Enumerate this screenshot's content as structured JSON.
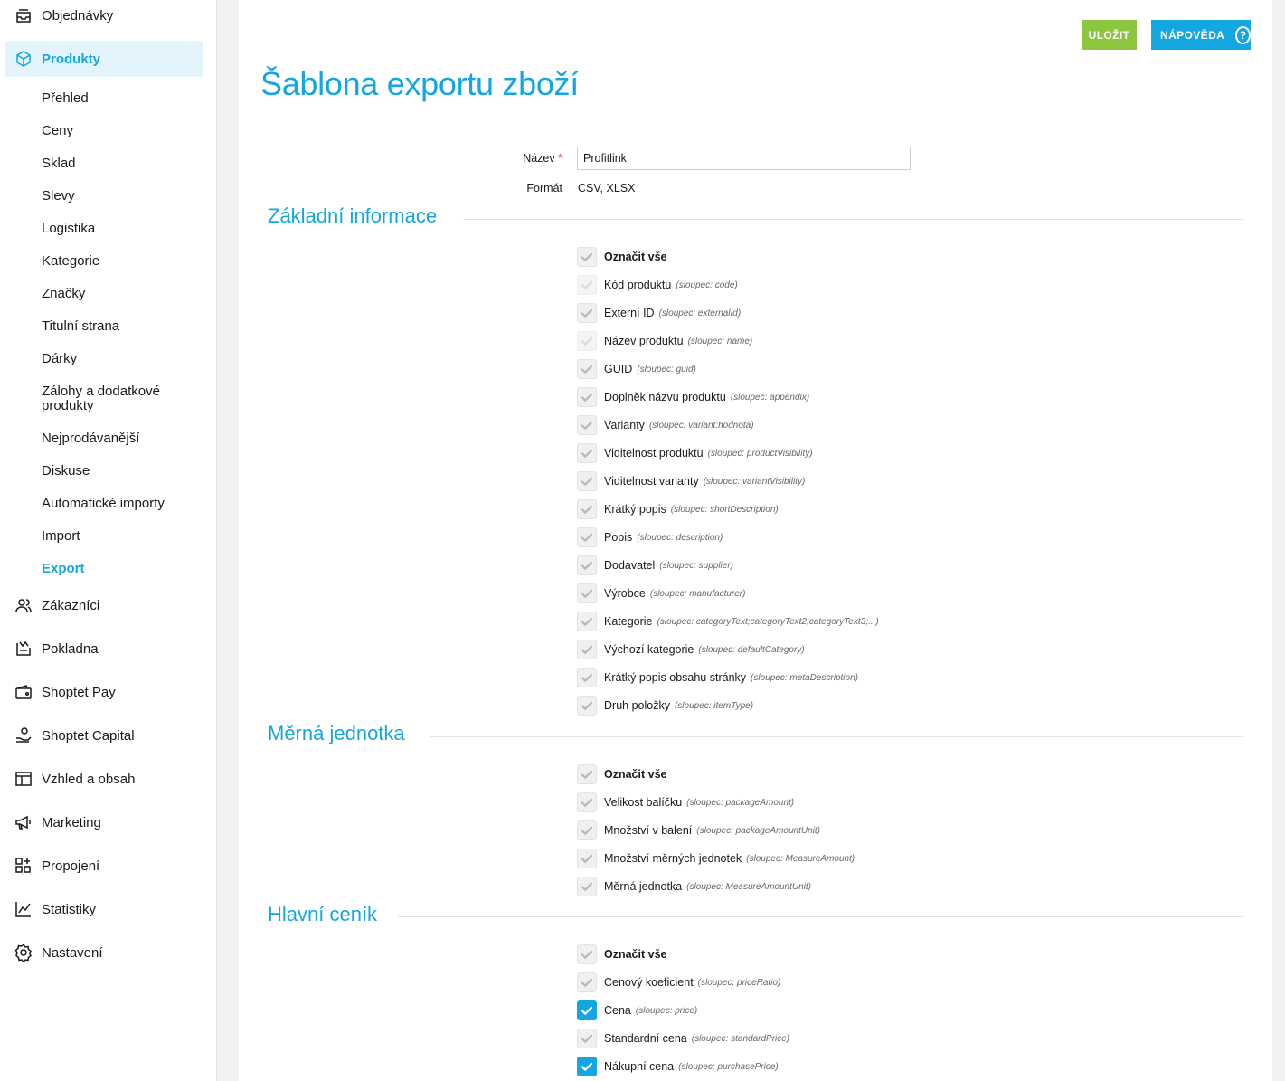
{
  "sidebar": {
    "top_item": {
      "label": "Objednávky",
      "icon": "box-tray-icon"
    },
    "active_item": {
      "label": "Produkty",
      "icon": "cube-icon"
    },
    "sub_items": [
      "Přehled",
      "Ceny",
      "Sklad",
      "Slevy",
      "Logistika",
      "Kategorie",
      "Značky",
      "Titulní strana",
      "Dárky",
      "Zálohy a dodatkové produkty",
      "Nejprodávanější",
      "Diskuse",
      "Automatické importy",
      "Import",
      "Export"
    ],
    "active_sub": "Export",
    "main_items": [
      {
        "label": "Zákazníci",
        "icon": "users-icon"
      },
      {
        "label": "Pokladna",
        "icon": "cash-register-icon"
      },
      {
        "label": "Shoptet Pay",
        "icon": "wallet-icon"
      },
      {
        "label": "Shoptet Capital",
        "icon": "hand-coin-icon"
      },
      {
        "label": "Vzhled a obsah",
        "icon": "layout-icon"
      },
      {
        "label": "Marketing",
        "icon": "megaphone-icon"
      },
      {
        "label": "Propojení",
        "icon": "apps-icon"
      },
      {
        "label": "Statistiky",
        "icon": "chart-icon"
      },
      {
        "label": "Nastavení",
        "icon": "gear-icon"
      }
    ]
  },
  "toolbar": {
    "save_label": "ULOŽIT",
    "help_label": "NÁPOVĚDA"
  },
  "page": {
    "title": "Šablona exportu zboží"
  },
  "form": {
    "name_label": "Název",
    "name_required": "*",
    "name_value": "Profitlink",
    "format_label": "Formát",
    "format_value": "CSV, XLSX"
  },
  "sections": [
    {
      "title": "Základní informace",
      "items": [
        {
          "label": "Označit vše",
          "column": "",
          "bold": true,
          "state": "checked-gray"
        },
        {
          "label": "Kód produktu",
          "column": "(sloupec: code)",
          "state": "disabled"
        },
        {
          "label": "Externí ID",
          "column": "(sloupec: externalId)",
          "state": "checked-gray"
        },
        {
          "label": "Název produktu",
          "column": "(sloupec: name)",
          "state": "disabled"
        },
        {
          "label": "GUID",
          "column": "(sloupec: guid)",
          "state": "checked-gray"
        },
        {
          "label": "Doplněk názvu produktu",
          "column": "(sloupec: appendix)",
          "state": "checked-gray"
        },
        {
          "label": "Varianty",
          "column": "(sloupec: variant:hodnota)",
          "state": "checked-gray"
        },
        {
          "label": "Viditelnost produktu",
          "column": "(sloupec: productVisibility)",
          "state": "checked-gray"
        },
        {
          "label": "Viditelnost varianty",
          "column": "(sloupec: variantVisibility)",
          "state": "checked-gray"
        },
        {
          "label": "Krátký popis",
          "column": "(sloupec: shortDescription)",
          "state": "checked-gray"
        },
        {
          "label": "Popis",
          "column": "(sloupec: description)",
          "state": "checked-gray"
        },
        {
          "label": "Dodavatel",
          "column": "(sloupec: supplier)",
          "state": "checked-gray"
        },
        {
          "label": "Výrobce",
          "column": "(sloupec: manufacturer)",
          "state": "checked-gray"
        },
        {
          "label": "Kategorie",
          "column": "(sloupec: categoryText;categoryText2;categoryText3;...)",
          "state": "checked-gray"
        },
        {
          "label": "Výchozí kategorie",
          "column": "(sloupec: defaultCategory)",
          "state": "checked-gray"
        },
        {
          "label": "Krátký popis obsahu stránky",
          "column": "(sloupec: metaDescription)",
          "state": "checked-gray"
        },
        {
          "label": "Druh položky",
          "column": "(sloupec: itemType)",
          "state": "checked-gray"
        }
      ]
    },
    {
      "title": "Měrná jednotka",
      "items": [
        {
          "label": "Označit vše",
          "column": "",
          "bold": true,
          "state": "checked-gray"
        },
        {
          "label": "Velikost balíčku",
          "column": "(sloupec: packageAmount)",
          "state": "checked-gray"
        },
        {
          "label": "Množství v balení",
          "column": "(sloupec: packageAmountUnit)",
          "state": "checked-gray"
        },
        {
          "label": "Množství měrných jednotek",
          "column": "(sloupec: MeasureAmount)",
          "state": "checked-gray"
        },
        {
          "label": "Měrná jednotka",
          "column": "(sloupec: MeasureAmountUnit)",
          "state": "checked-gray"
        }
      ]
    },
    {
      "title": "Hlavní ceník",
      "items": [
        {
          "label": "Označit vše",
          "column": "",
          "bold": true,
          "state": "checked-gray"
        },
        {
          "label": "Cenový koeficient",
          "column": "(sloupec: priceRatio)",
          "state": "checked-gray"
        },
        {
          "label": "Cena",
          "column": "(sloupec: price)",
          "state": "checked"
        },
        {
          "label": "Standardní cena",
          "column": "(sloupec: standardPrice)",
          "state": "checked-gray"
        },
        {
          "label": "Nákupní cena",
          "column": "(sloupec: purchasePrice)",
          "state": "checked"
        }
      ]
    }
  ],
  "colors": {
    "accent": "#14a6e0",
    "save": "#8cc63e",
    "active_bg": "#e4f4fc"
  }
}
